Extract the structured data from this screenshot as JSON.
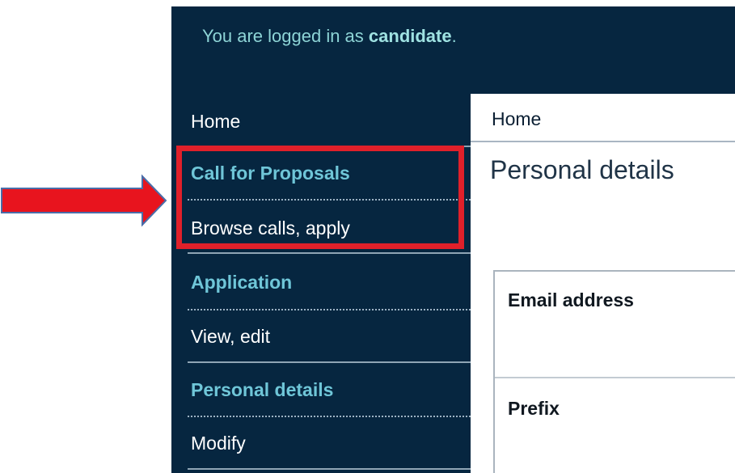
{
  "header": {
    "logged_in_prefix": "You are logged in as ",
    "username": "candidate",
    "logged_in_suffix": "."
  },
  "sidebar": {
    "items": [
      {
        "label": "Home",
        "kind": "link"
      },
      {
        "label": "Call for Proposals",
        "kind": "section"
      },
      {
        "label": "Browse calls, apply",
        "kind": "link"
      },
      {
        "label": "Application",
        "kind": "section"
      },
      {
        "label": "View, edit",
        "kind": "link"
      },
      {
        "label": "Personal details",
        "kind": "section"
      },
      {
        "label": "Modify",
        "kind": "link"
      }
    ]
  },
  "breadcrumb": {
    "current": "Home"
  },
  "main": {
    "title": "Personal details",
    "form_fields": [
      {
        "label": "Email address"
      },
      {
        "label": "Prefix"
      }
    ]
  },
  "annotation": {
    "highlight_color": "#e0202a",
    "arrow_color": "#e8141e",
    "arrow_outline_color": "#4a6da8"
  },
  "colors": {
    "nav_background": "#062640",
    "section_heading": "#6fc6d8",
    "header_text": "#8dd4d6"
  }
}
